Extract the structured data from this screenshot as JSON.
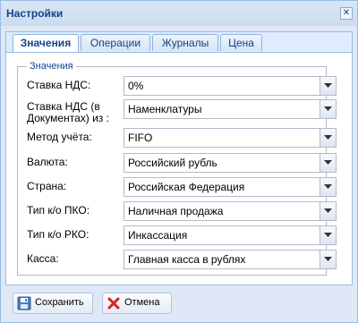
{
  "window": {
    "title": "Настройки",
    "close_glyph": "✕"
  },
  "tabs": [
    {
      "label": "Значения",
      "active": true
    },
    {
      "label": "Операции",
      "active": false
    },
    {
      "label": "Журналы",
      "active": false
    },
    {
      "label": "Цена",
      "active": false
    }
  ],
  "form": {
    "legend": "Значения",
    "fields": [
      {
        "label": "Ставка НДС:",
        "value": "0%"
      },
      {
        "label": "Ставка НДС (в Документах) из :",
        "value": "Наменклатуры"
      },
      {
        "label": "Метод учёта:",
        "value": "FIFO"
      },
      {
        "label": "Валюта:",
        "value": "Российский рубль"
      },
      {
        "label": "Страна:",
        "value": "Российская Федерация"
      },
      {
        "label": "Тип к/о ПКО:",
        "value": "Наличная продажа"
      },
      {
        "label": "Тип к/о РКО:",
        "value": "Инкассация"
      },
      {
        "label": "Касса:",
        "value": "Главная касса в рублях"
      }
    ]
  },
  "buttons": {
    "save": "Сохранить",
    "cancel": "Отмена"
  },
  "colors": {
    "title_text": "#15428b",
    "window_bg": "#dfe8f6",
    "border": "#99bbe8"
  }
}
